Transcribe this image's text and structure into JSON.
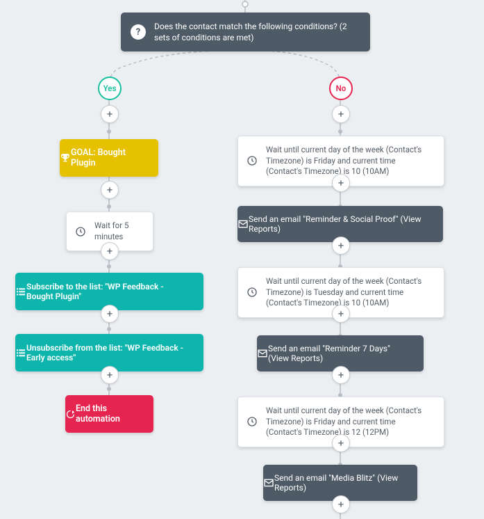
{
  "condition": {
    "text": "Does the contact match the following conditions? (2 sets of conditions are met)"
  },
  "badges": {
    "yes": "Yes",
    "no": "No"
  },
  "plus": "+",
  "left": {
    "goal": "GOAL: Bought Plugin",
    "wait": "Wait for 5 minutes",
    "subscribe": "Subscribe to the list: \"WP Feedback - Bought Plugin\"",
    "unsubscribe": "Unsubscribe from the list: \"WP Feedback - Early access\"",
    "end": "End this automation"
  },
  "right": {
    "wait1": "Wait until current day of the week (Contact's Timezone) is Friday and current time (Contact's Timezone) is 10 (10AM)",
    "email1": "Send an email \"Reminder & Social Proof\" (View Reports)",
    "wait2": "Wait until current day of the week (Contact's Timezone) is Tuesday and current time (Contact's Timezone) is 10 (10AM)",
    "email2": "Send an email \"Reminder 7 Days\" (View Reports)",
    "wait3": "Wait until current day of the week (Contact's Timezone) is Friday and current time (Contact's Timezone) is 12 (12PM)",
    "email3": "Send an email \"Media Blitz\" (View Reports)"
  }
}
